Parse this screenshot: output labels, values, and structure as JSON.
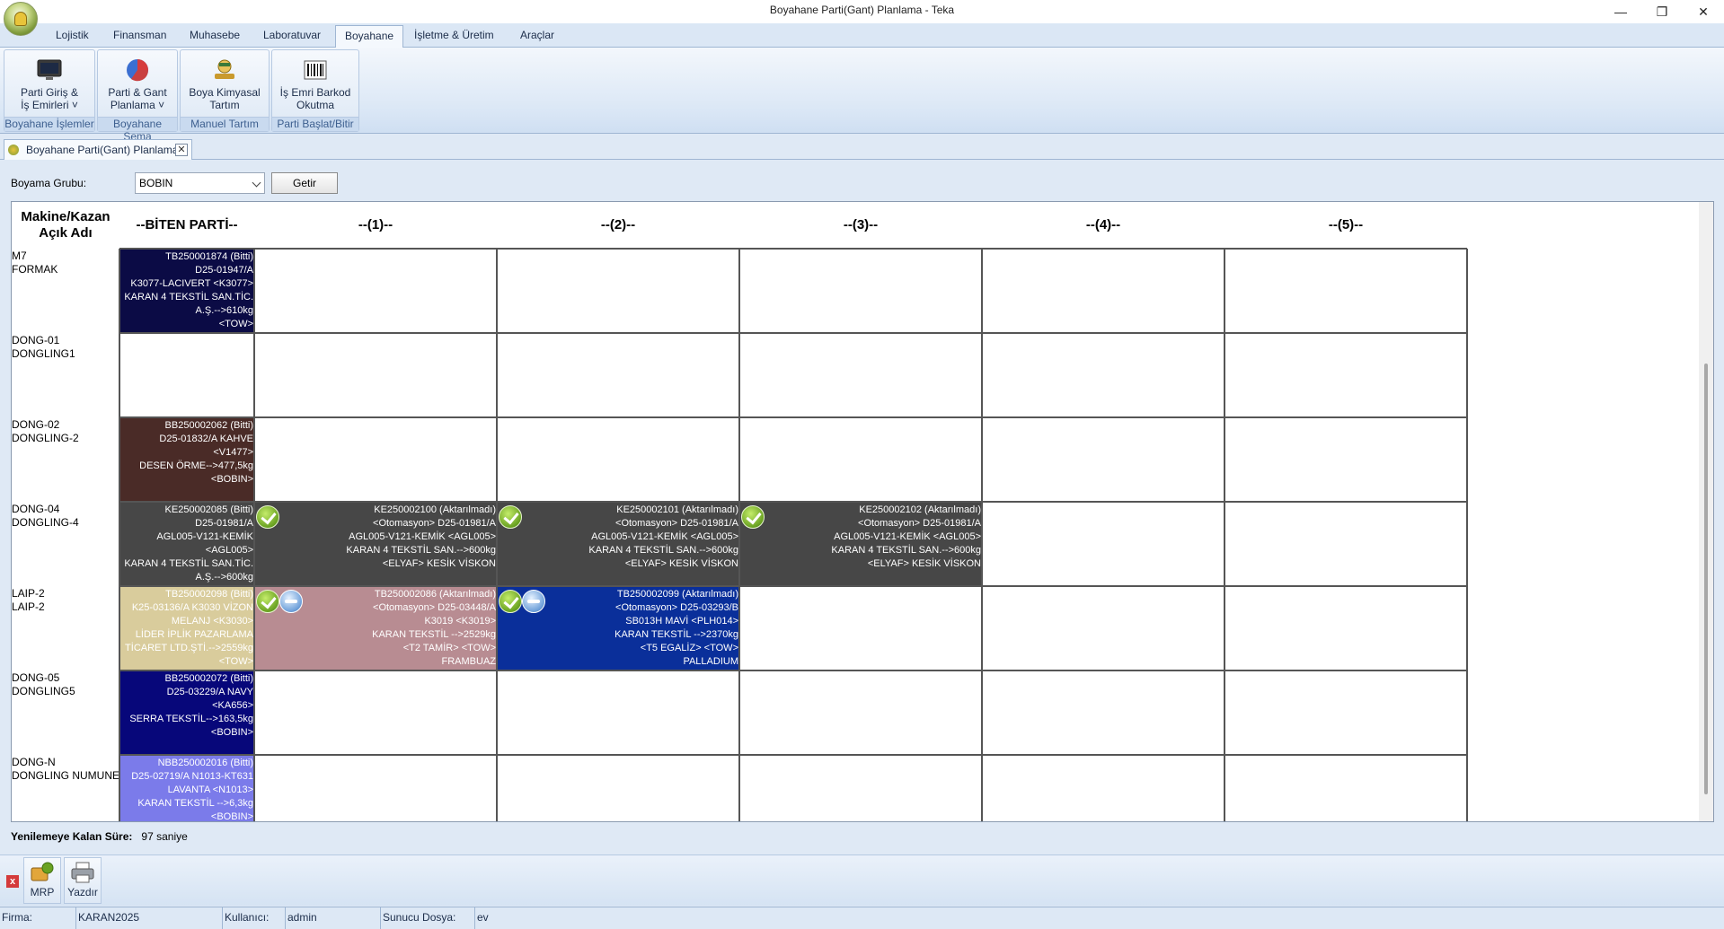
{
  "window": {
    "title": "Boyahane Parti(Gant) Planlama - Teka",
    "minimize": "—",
    "maximize": "❐",
    "close": "✕"
  },
  "menu": [
    "Lojistik",
    "Finansman",
    "Muhasebe",
    "Laboratuvar",
    "Boyahane",
    "İşletme & Üretim",
    "Araçlar"
  ],
  "ribbon": {
    "groups": [
      {
        "button": "Parti Giriş &\nİş Emirleri ˅",
        "group": "Boyahane İşlemler",
        "icon": "monitor-icon"
      },
      {
        "button": "Parti & Gant\nPlanlama ˅",
        "group": "Boyahane Şema",
        "icon": "pie-chart-icon"
      },
      {
        "button": "Boya Kimyasal\nTartım",
        "group": "Manuel Tartım",
        "icon": "scale-icon"
      },
      {
        "button": "İş Emri Barkod\nOkutma",
        "group": "Parti Başlat/Bitir",
        "icon": "barcode-icon"
      }
    ]
  },
  "doc_tab": {
    "label": "Boyahane Parti(Gant) Planlama",
    "close": "✕"
  },
  "filter": {
    "label": "Boyama Grubu:",
    "value": "BOBIN",
    "button": "Getir"
  },
  "grid": {
    "headers": [
      "Makine/Kazan\nAçık Adı",
      "--BİTEN PARTİ--",
      "--(1)--",
      "--(2)--",
      "--(3)--",
      "--(4)--",
      "--(5)--"
    ],
    "rows": [
      {
        "name": [
          "M7",
          "FORMAK"
        ],
        "cells": [
          {
            "col": 1,
            "bg": "#0b0b45",
            "fg": "#ffffff",
            "lines": [
              "TB250001874 (Bitti)",
              "D25-01947/A",
              "K3077-LACIVERT <K3077>",
              "KARAN 4 TEKSTİL SAN.TİC.",
              "A.Ş.-->610kg",
              "<TOW>"
            ]
          }
        ]
      },
      {
        "name": [
          "DONG-01",
          "DONGLING1"
        ],
        "cells": []
      },
      {
        "name": [
          "DONG-02",
          "DONGLING-2"
        ],
        "cells": [
          {
            "col": 1,
            "bg": "#4a2b27",
            "fg": "#ffffff",
            "lines": [
              "BB250002062 (Bitti)",
              "D25-01832/A KAHVE",
              "<V1477>",
              "DESEN ÖRME-->477,5kg",
              "<BOBIN>"
            ]
          }
        ]
      },
      {
        "name": [
          "DONG-04",
          "DONGLING-4"
        ],
        "cells": [
          {
            "col": 1,
            "bg": "#474747",
            "fg": "#ffffff",
            "lines": [
              "KE250002085 (Bitti)",
              "D25-01981/A",
              "AGL005-V121-KEMİK",
              "<AGL005>",
              "KARAN 4 TEKSTİL SAN.TİC.",
              "A.Ş.-->600kg"
            ]
          },
          {
            "col": 2,
            "bg": "#474747",
            "fg": "#ffffff",
            "badges": [
              "ok"
            ],
            "lines": [
              "KE250002100 (Aktarılmadı)",
              "<Otomasyon> D25-01981/A",
              "AGL005-V121-KEMİK <AGL005>",
              "KARAN 4 TEKSTİL SAN.-->600kg",
              "<ELYAF> KESİK VİSKON"
            ]
          },
          {
            "col": 3,
            "bg": "#474747",
            "fg": "#ffffff",
            "badges": [
              "ok"
            ],
            "lines": [
              "KE250002101 (Aktarılmadı)",
              "<Otomasyon> D25-01981/A",
              "AGL005-V121-KEMİK <AGL005>",
              "KARAN 4 TEKSTİL SAN.-->600kg",
              "<ELYAF> KESİK VİSKON"
            ]
          },
          {
            "col": 4,
            "bg": "#474747",
            "fg": "#ffffff",
            "badges": [
              "ok"
            ],
            "lines": [
              "KE250002102 (Aktarılmadı)",
              "<Otomasyon> D25-01981/A",
              "AGL005-V121-KEMİK <AGL005>",
              "KARAN 4 TEKSTİL SAN.-->600kg",
              "<ELYAF> KESİK VİSKON"
            ]
          }
        ]
      },
      {
        "name": [
          "LAIP-2",
          "LAIP-2"
        ],
        "cells": [
          {
            "col": 1,
            "bg": "#d9cc9c",
            "fg": "#ffffff",
            "lines": [
              "TB250002098 (Bitti)",
              "K25-03136/A K3030 VİZON",
              "MELANJ <K3030>",
              "LİDER İPLİK PAZARLAMA",
              "TİCARET LTD.ŞTİ.-->2559kg",
              "<TOW>"
            ]
          },
          {
            "col": 2,
            "bg": "#b88c92",
            "fg": "#ffffff",
            "badges": [
              "ok",
              "sync"
            ],
            "lines": [
              "TB250002086 (Aktarılmadı)",
              "<Otomasyon> D25-03448/A",
              "K3019 <K3019>",
              "KARAN TEKSTİL -->2529kg",
              "<T2 TAMİR>    <TOW>",
              "FRAMBUAZ"
            ]
          },
          {
            "col": 3,
            "bg": "#0a2f9a",
            "fg": "#ffffff",
            "badges": [
              "ok",
              "sync"
            ],
            "lines": [
              "TB250002099 (Aktarılmadı)",
              "<Otomasyon> D25-03293/B",
              "SB013H MAVİ <PLH014>",
              "KARAN TEKSTİL -->2370kg",
              "<T5 EGALİZ>    <TOW>",
              "PALLADIUM"
            ]
          }
        ]
      },
      {
        "name": [
          "DONG-05",
          "DONGLING5"
        ],
        "cells": [
          {
            "col": 1,
            "bg": "#07077a",
            "fg": "#ffffff",
            "lines": [
              "BB250002072 (Bitti)",
              "D25-03229/A NAVY",
              "<KA656>",
              "SERRA TEKSTİL-->163,5kg",
              "<BOBIN>"
            ]
          }
        ]
      },
      {
        "name": [
          "DONG-N",
          "DONGLING NUMUNE"
        ],
        "cells": [
          {
            "col": 1,
            "bg": "#7b7bea",
            "fg": "#ffffff",
            "lines": [
              "NBB250002016 (Bitti)",
              "D25-02719/A N1013-KT631",
              "LAVANTA <N1013>",
              "KARAN TEKSTİL -->6,3kg",
              "<BOBIN>"
            ]
          }
        ]
      }
    ]
  },
  "refresh": {
    "label": "Yenilemeye Kalan Süre:",
    "value": "97 saniye"
  },
  "toolbar": [
    {
      "label": "MRP",
      "icon": "mrp-icon"
    },
    {
      "label": "Yazdır",
      "icon": "printer-icon"
    }
  ],
  "status": [
    {
      "label": "Firma:",
      "value": "KARAN2025"
    },
    {
      "label": "Kullanıcı:",
      "value": "admin"
    },
    {
      "label": "Sunucu Dosya:",
      "value": "ev"
    }
  ]
}
